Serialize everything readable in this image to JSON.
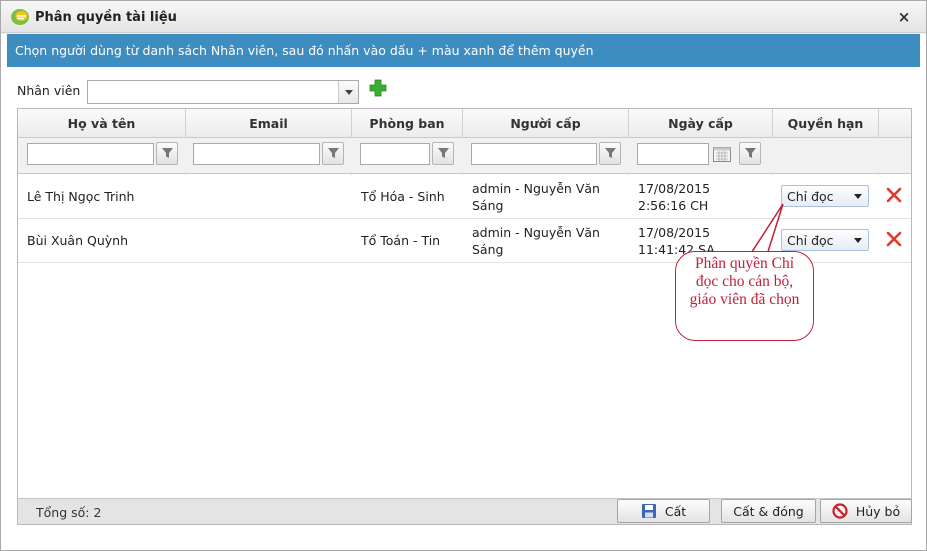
{
  "window": {
    "title": "Phân quyền tài liệu",
    "close_label": "×"
  },
  "info_bar": {
    "text": "Chọn người dùng từ danh sách Nhân viên, sau đó nhấn vào dấu + màu xanh để thêm quyền"
  },
  "employee_picker": {
    "label": "Nhân viên",
    "value": ""
  },
  "grid": {
    "columns": [
      "Họ và tên",
      "Email",
      "Phòng ban",
      "Người cấp",
      "Ngày cấp",
      "Quyền hạn"
    ],
    "rows": [
      {
        "name": "Lê Thị Ngọc Trinh",
        "email": "",
        "department": "Tổ Hóa - Sinh",
        "granted_by": "admin - Nguyễn Văn Sáng",
        "granted_date": "17/08/2015 2:56:16 CH",
        "permission": "Chỉ đọc"
      },
      {
        "name": "Bùi Xuân Quỳnh",
        "email": "",
        "department": "Tổ Toán - Tin",
        "granted_by": "admin - Nguyễn Văn Sáng",
        "granted_date": "17/08/2015 11:41:42 SA",
        "permission": "Chỉ đọc"
      }
    ],
    "total_label": "Tổng số: 2"
  },
  "buttons": {
    "save": "Cất",
    "save_close": "Cất & đóng",
    "cancel": "Hủy bỏ"
  },
  "callout": {
    "text": "Phân quyền Chỉ đọc cho cán bộ, giáo viên đã chọn"
  },
  "colors": {
    "info_bar": "#3d8dc0",
    "add_icon": "#3cae2f",
    "delete_icon": "#e03c2c",
    "callout": "#c0203a"
  }
}
